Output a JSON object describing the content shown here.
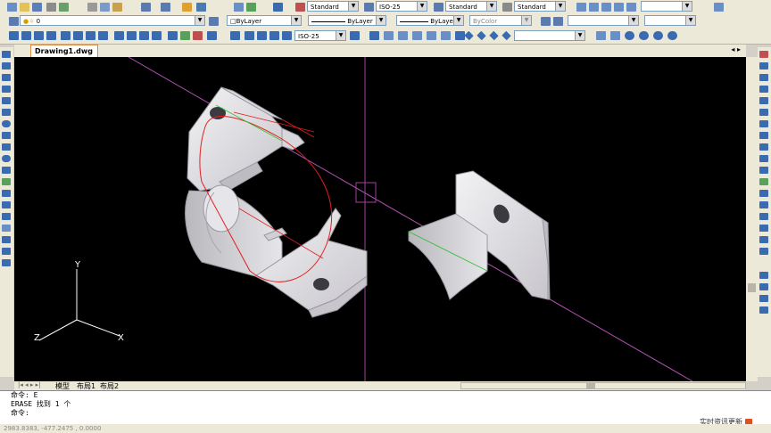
{
  "toolbar": {
    "text_style": "Standard",
    "dim_style": "ISO-25",
    "table_style": "Standard",
    "mleader_style": "Standard",
    "layer": "0",
    "layer_control": "ByLayer",
    "linetype": "ByLayer",
    "lineweight": "ByLayer",
    "color": "ByColor",
    "dim_style2": "ISO-25"
  },
  "document": {
    "tab": "Drawing1.dwg"
  },
  "layout_tabs": [
    "模型",
    "布局1",
    "布局2"
  ],
  "ucs": {
    "x": "X",
    "y": "Y",
    "z": "Z"
  },
  "command": {
    "line1": "命令: E",
    "line2": "ERASE 找到 1 个",
    "prompt": "命令:"
  },
  "status": {
    "coords": "2983.8383, -477.2475 , 0.0000"
  },
  "watermark": "实时资讯更新",
  "colors": {
    "canvas": "#000000",
    "crosshair": "#a040a0",
    "accent": "#e08a40"
  }
}
